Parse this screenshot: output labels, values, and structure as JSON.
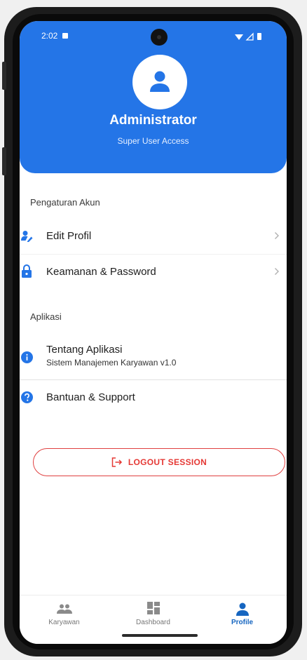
{
  "status_bar": {
    "time": "2:02"
  },
  "profile": {
    "name": "Administrator",
    "role": "Super User Access"
  },
  "sections": {
    "account": {
      "title": "Pengaturan Akun",
      "items": [
        {
          "label": "Edit Profil",
          "icon": "user-edit-icon"
        },
        {
          "label": "Keamanan & Password",
          "icon": "lock-icon"
        }
      ]
    },
    "app": {
      "title": "Aplikasi",
      "items": [
        {
          "label": "Tentang Aplikasi",
          "subtitle": "Sistem Manajemen Karyawan v1.0",
          "icon": "info-icon"
        },
        {
          "label": "Bantuan & Support",
          "icon": "help-icon"
        }
      ]
    }
  },
  "logout": {
    "label": "LOGOUT SESSION",
    "icon": "logout-icon",
    "color": "#e53935"
  },
  "bottom_nav": {
    "items": [
      {
        "label": "Karyawan",
        "icon": "people-icon",
        "active": false
      },
      {
        "label": "Dashboard",
        "icon": "dashboard-icon",
        "active": false
      },
      {
        "label": "Profile",
        "icon": "person-icon",
        "active": true
      }
    ]
  },
  "colors": {
    "primary": "#2475e7",
    "active_nav": "#1565c0",
    "danger": "#e53935"
  }
}
